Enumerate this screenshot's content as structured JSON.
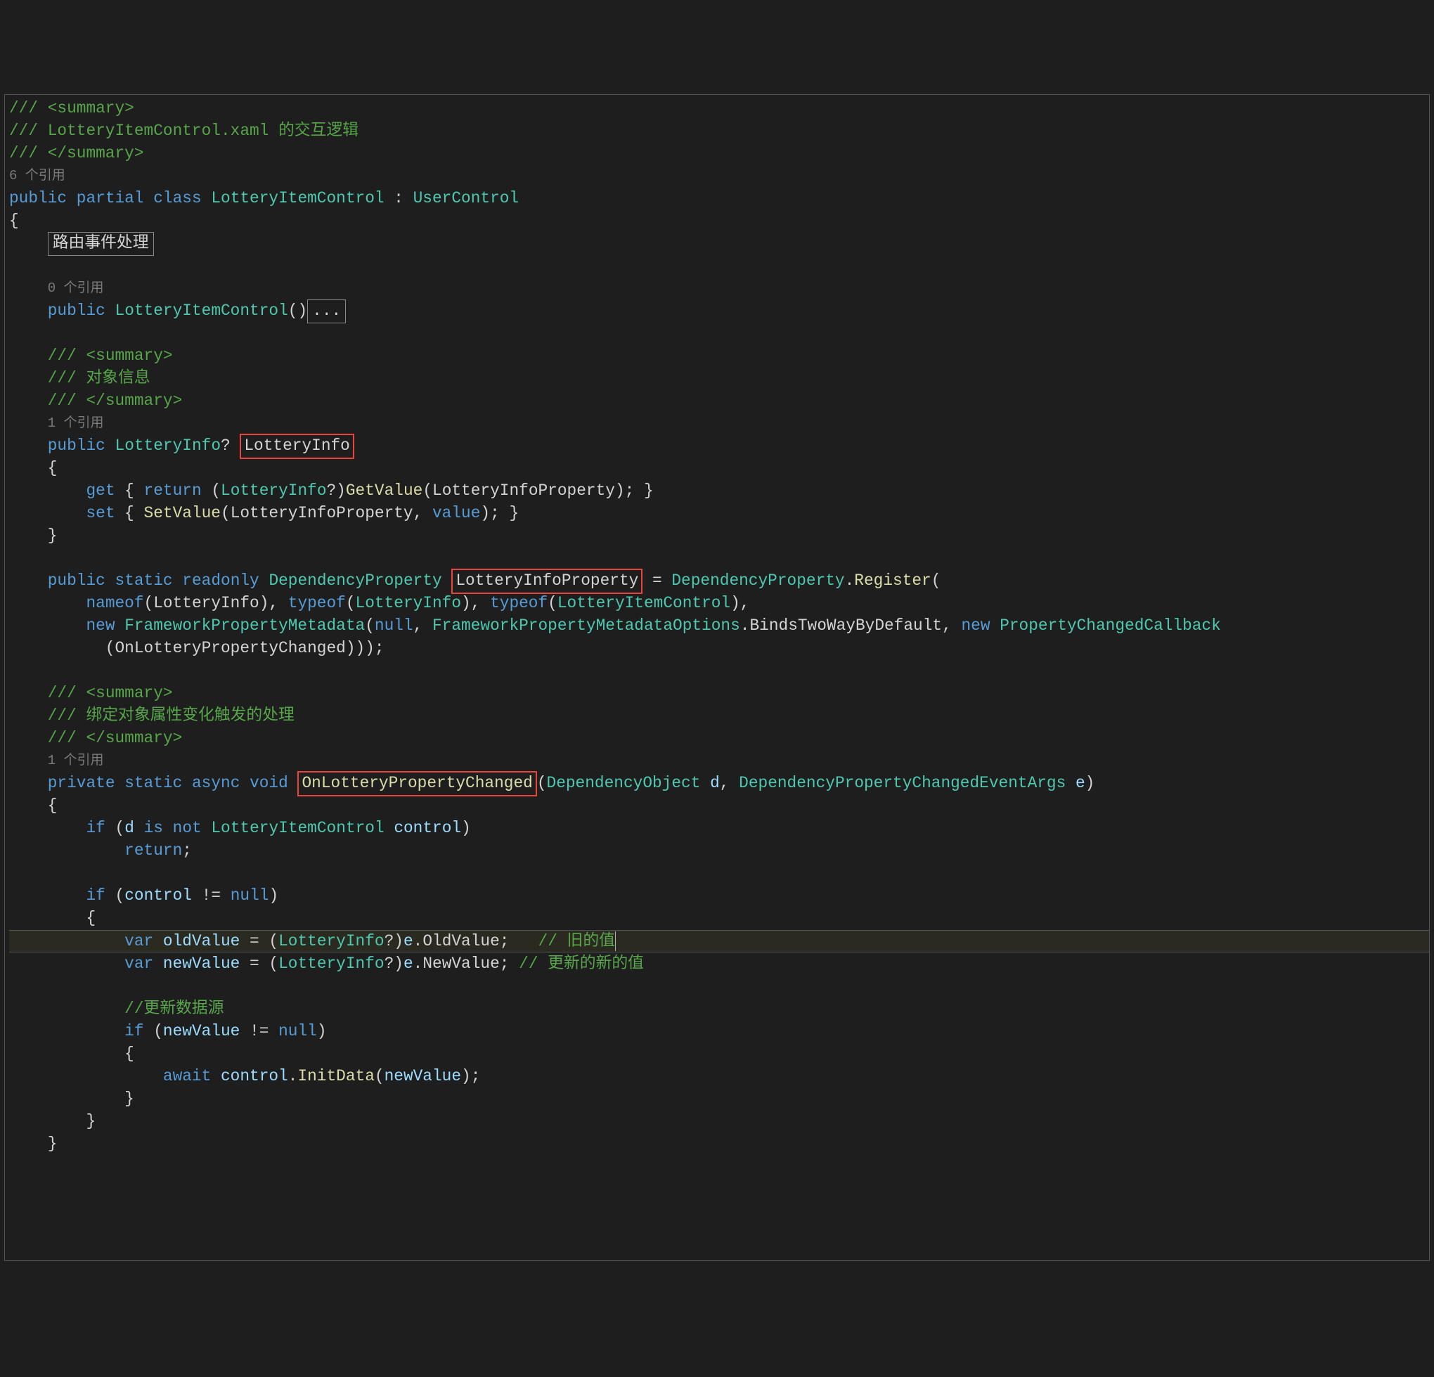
{
  "doc_summary_open": "/// <summary>",
  "doc_summary_close": "/// </summary>",
  "doc_class_desc": "/// LotteryItemControl.xaml 的交互逻辑",
  "ref_6": "6 个引用",
  "ref_0": "0 个引用",
  "ref_1": "1 个引用",
  "kw_public": "public",
  "kw_partial": "partial",
  "kw_class": "class",
  "kw_private": "private",
  "kw_static": "static",
  "kw_readonly": "readonly",
  "kw_async": "async",
  "kw_void": "void",
  "kw_get": "get",
  "kw_set": "set",
  "kw_return": "return",
  "kw_new": "new",
  "kw_null": "null",
  "kw_nameof": "nameof",
  "kw_typeof": "typeof",
  "kw_value": "value",
  "kw_if": "if",
  "kw_is": "is",
  "kw_not": "not",
  "kw_var": "var",
  "kw_await": "await",
  "type_LotteryItemControl": "LotteryItemControl",
  "type_UserControl": "UserControl",
  "type_LotteryInfo": "LotteryInfo",
  "type_DependencyProperty": "DependencyProperty",
  "type_FrameworkPropertyMetadata": "FrameworkPropertyMetadata",
  "type_FrameworkPropertyMetadataOptions": "FrameworkPropertyMetadataOptions",
  "type_PropertyChangedCallback": "PropertyChangedCallback",
  "type_DependencyObject": "DependencyObject",
  "type_DependencyPropertyChangedEventArgs": "DependencyPropertyChangedEventArgs",
  "method_GetValue": "GetValue",
  "method_SetValue": "SetValue",
  "method_Register": "Register",
  "method_OnLotteryPropertyChanged": "OnLotteryPropertyChanged",
  "method_InitData": "InitData",
  "prop_LotteryInfo": "LotteryInfo",
  "prop_LotteryInfoProperty": "LotteryInfoProperty",
  "prop_BindsTwoWayByDefault": "BindsTwoWayByDefault",
  "prop_OldValue": "OldValue",
  "prop_NewValue": "NewValue",
  "param_d": "d",
  "param_e": "e",
  "param_control": "control",
  "param_oldValue": "oldValue",
  "param_newValue": "newValue",
  "region_label": "路由事件处理",
  "collapsed_dots": "...",
  "doc_obj_info": "/// 对象信息",
  "doc_bind_change": "/// 绑定对象属性变化触发的处理",
  "cmt_old": "// 旧的值",
  "cmt_new": "// 更新的新的值",
  "cmt_update": "//更新数据源",
  "boxes": [
    "LotteryInfo",
    "LotteryInfoProperty",
    "OnLotteryPropertyChanged"
  ]
}
